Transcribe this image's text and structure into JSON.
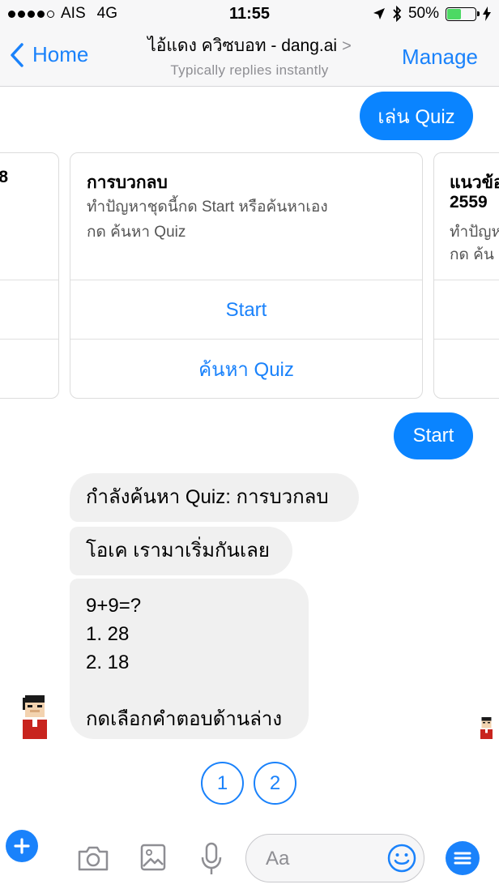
{
  "status_bar": {
    "carrier": "AIS",
    "network": "4G",
    "time": "11:55",
    "battery": "50%",
    "battery_level": 0.5,
    "signal_bars": 4
  },
  "nav": {
    "back_label": "Home",
    "title": "ไอ้แดง ควิซบอท - dang.ai",
    "subtitle": "Typically replies instantly",
    "manage_label": "Manage"
  },
  "messages": {
    "play_quiz": "เล่น Quiz",
    "start": "Start",
    "searching": "กำลังค้นหา Quiz: การบวกลบ",
    "ok_start": "โอเค เรามาเริ่มกันเลย",
    "question_lines": [
      "9+9=?",
      "1. 28",
      "2. 18",
      "",
      "กดเลือกคำตอบด้านล่าง"
    ]
  },
  "carousel": {
    "left_card": {
      "title_fragment": "8"
    },
    "center_card": {
      "title": "การบวกลบ",
      "subtitle_line1": "ทำปัญหาชุดนี้กด Start หรือค้นหาเอง",
      "subtitle_line2": "กด ค้นหา Quiz",
      "button_start": "Start",
      "button_search": "ค้นหา Quiz"
    },
    "right_card": {
      "title_line1": "แนวข้อ",
      "title_line2": "2559",
      "subtitle_line1": "ทำปัญห",
      "subtitle_line2": "กด ค้น"
    }
  },
  "quick_replies": [
    "1",
    "2"
  ],
  "composer": {
    "placeholder": "Aa",
    "icons": [
      "plus-icon",
      "camera-icon",
      "gallery-icon",
      "microphone-icon",
      "smiley-icon",
      "menu-icon"
    ]
  },
  "colors": {
    "accent": "#1a82fb",
    "outgoing_bubble": "#0a84ff",
    "incoming_bubble": "#f0f0f0",
    "nav_background": "#f7f7f8"
  }
}
